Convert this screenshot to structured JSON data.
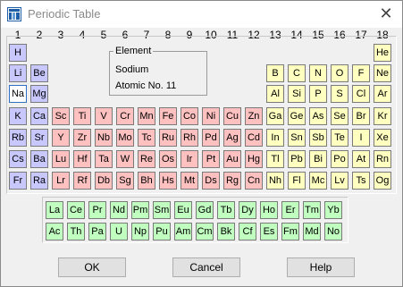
{
  "window": {
    "title": "Periodic Table",
    "close_glyph": "✕",
    "icon": "app-icon"
  },
  "group_numbers": [
    "1",
    "2",
    "3",
    "4",
    "5",
    "6",
    "7",
    "8",
    "9",
    "10",
    "11",
    "12",
    "13",
    "14",
    "15",
    "16",
    "17",
    "18"
  ],
  "colors": {
    "s_block": "#c8c8ff",
    "d_block": "#ffc0c0",
    "p_block": "#ffffc0",
    "f_block": "#c0ffc0"
  },
  "element_info": {
    "legend": "Element",
    "name": "Sodium",
    "atomic_number": "Atomic No. 11"
  },
  "main_table": [
    [
      [
        "H",
        "s"
      ],
      null,
      null,
      null,
      null,
      null,
      null,
      null,
      null,
      null,
      null,
      null,
      null,
      null,
      null,
      null,
      null,
      [
        "He",
        "p"
      ]
    ],
    [
      [
        "Li",
        "s"
      ],
      [
        "Be",
        "s"
      ],
      null,
      null,
      null,
      null,
      null,
      null,
      null,
      null,
      null,
      null,
      [
        "B",
        "p"
      ],
      [
        "C",
        "p"
      ],
      [
        "N",
        "p"
      ],
      [
        "O",
        "p"
      ],
      [
        "F",
        "p"
      ],
      [
        "Ne",
        "p"
      ]
    ],
    [
      [
        "Na",
        "sel"
      ],
      [
        "Mg",
        "s"
      ],
      null,
      null,
      null,
      null,
      null,
      null,
      null,
      null,
      null,
      null,
      [
        "Al",
        "p"
      ],
      [
        "Si",
        "p"
      ],
      [
        "P",
        "p"
      ],
      [
        "S",
        "p"
      ],
      [
        "Cl",
        "p"
      ],
      [
        "Ar",
        "p"
      ]
    ],
    [
      [
        "K",
        "s"
      ],
      [
        "Ca",
        "s"
      ],
      [
        "Sc",
        "d"
      ],
      [
        "Ti",
        "d"
      ],
      [
        "V",
        "d"
      ],
      [
        "Cr",
        "d"
      ],
      [
        "Mn",
        "d"
      ],
      [
        "Fe",
        "d"
      ],
      [
        "Co",
        "d"
      ],
      [
        "Ni",
        "d"
      ],
      [
        "Cu",
        "d"
      ],
      [
        "Zn",
        "d"
      ],
      [
        "Ga",
        "p"
      ],
      [
        "Ge",
        "p"
      ],
      [
        "As",
        "p"
      ],
      [
        "Se",
        "p"
      ],
      [
        "Br",
        "p"
      ],
      [
        "Kr",
        "p"
      ]
    ],
    [
      [
        "Rb",
        "s"
      ],
      [
        "Sr",
        "s"
      ],
      [
        "Y",
        "d"
      ],
      [
        "Zr",
        "d"
      ],
      [
        "Nb",
        "d"
      ],
      [
        "Mo",
        "d"
      ],
      [
        "Tc",
        "d"
      ],
      [
        "Ru",
        "d"
      ],
      [
        "Rh",
        "d"
      ],
      [
        "Pd",
        "d"
      ],
      [
        "Ag",
        "d"
      ],
      [
        "Cd",
        "d"
      ],
      [
        "In",
        "p"
      ],
      [
        "Sn",
        "p"
      ],
      [
        "Sb",
        "p"
      ],
      [
        "Te",
        "p"
      ],
      [
        "I",
        "p"
      ],
      [
        "Xe",
        "p"
      ]
    ],
    [
      [
        "Cs",
        "s"
      ],
      [
        "Ba",
        "s"
      ],
      [
        "Lu",
        "d"
      ],
      [
        "Hf",
        "d"
      ],
      [
        "Ta",
        "d"
      ],
      [
        "W",
        "d"
      ],
      [
        "Re",
        "d"
      ],
      [
        "Os",
        "d"
      ],
      [
        "Ir",
        "d"
      ],
      [
        "Pt",
        "d"
      ],
      [
        "Au",
        "d"
      ],
      [
        "Hg",
        "d"
      ],
      [
        "Tl",
        "p"
      ],
      [
        "Pb",
        "p"
      ],
      [
        "Bi",
        "p"
      ],
      [
        "Po",
        "p"
      ],
      [
        "At",
        "p"
      ],
      [
        "Rn",
        "p"
      ]
    ],
    [
      [
        "Fr",
        "s"
      ],
      [
        "Ra",
        "s"
      ],
      [
        "Lr",
        "d"
      ],
      [
        "Rf",
        "d"
      ],
      [
        "Db",
        "d"
      ],
      [
        "Sg",
        "d"
      ],
      [
        "Bh",
        "d"
      ],
      [
        "Hs",
        "d"
      ],
      [
        "Mt",
        "d"
      ],
      [
        "Ds",
        "d"
      ],
      [
        "Rg",
        "d"
      ],
      [
        "Cn",
        "d"
      ],
      [
        "Nh",
        "p"
      ],
      [
        "Fl",
        "p"
      ],
      [
        "Mc",
        "p"
      ],
      [
        "Lv",
        "p"
      ],
      [
        "Ts",
        "p"
      ],
      [
        "Og",
        "p"
      ]
    ]
  ],
  "f_block": [
    [
      "La",
      "Ce",
      "Pr",
      "Nd",
      "Pm",
      "Sm",
      "Eu",
      "Gd",
      "Tb",
      "Dy",
      "Ho",
      "Er",
      "Tm",
      "Yb"
    ],
    [
      "Ac",
      "Th",
      "Pa",
      "U",
      "Np",
      "Pu",
      "Am",
      "Cm",
      "Bk",
      "Cf",
      "Es",
      "Fm",
      "Md",
      "No"
    ]
  ],
  "buttons": {
    "ok": "OK",
    "cancel": "Cancel",
    "help": "Help"
  }
}
